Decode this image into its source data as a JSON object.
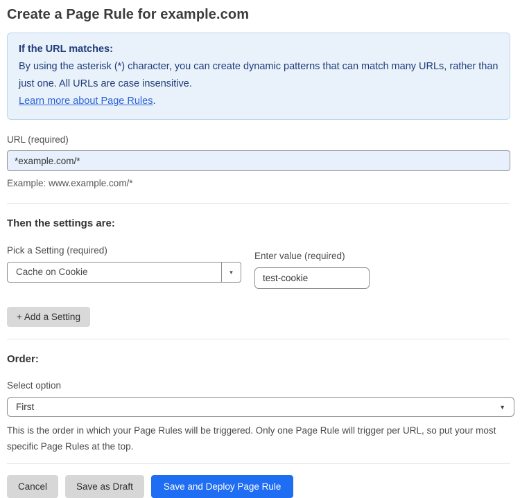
{
  "page": {
    "title": "Create a Page Rule for example.com"
  },
  "info_box": {
    "heading": "If the URL matches:",
    "body": "By using the asterisk (*) character, you can create dynamic patterns that can match many URLs, rather than just one. All URLs are case insensitive.",
    "link_label": "Learn more about Page Rules",
    "link_suffix": "."
  },
  "url_section": {
    "label": "URL (required)",
    "value": "*example.com/*",
    "example": "Example: www.example.com/*"
  },
  "settings_section": {
    "heading": "Then the settings are:",
    "setting_label": "Pick a Setting (required)",
    "setting_selected": "Cache on Cookie",
    "dropdown_caret": "▼",
    "value_label": "Enter value (required)",
    "value_text": "test-cookie",
    "add_button_label": "+ Add a Setting"
  },
  "order_section": {
    "heading": "Order:",
    "label": "Select option",
    "selected_option": "First",
    "caret": "▼",
    "help_text": "This is the order in which your Page Rules will be triggered. Only one Page Rule will trigger per URL, so put your most specific Page Rules at the top."
  },
  "footer": {
    "cancel_label": "Cancel",
    "save_draft_label": "Save as Draft",
    "save_deploy_label": "Save and Deploy Page Rule"
  },
  "colors": {
    "info_box_bg": "#e9f2fb",
    "info_box_border": "#b9d7f1",
    "info_text": "#1e3c78",
    "link_blue": "#2c62d9",
    "url_input_bg": "#e8f0fe",
    "primary_button_bg": "#1f6df2",
    "gray_button_bg": "#d7d7d7"
  }
}
